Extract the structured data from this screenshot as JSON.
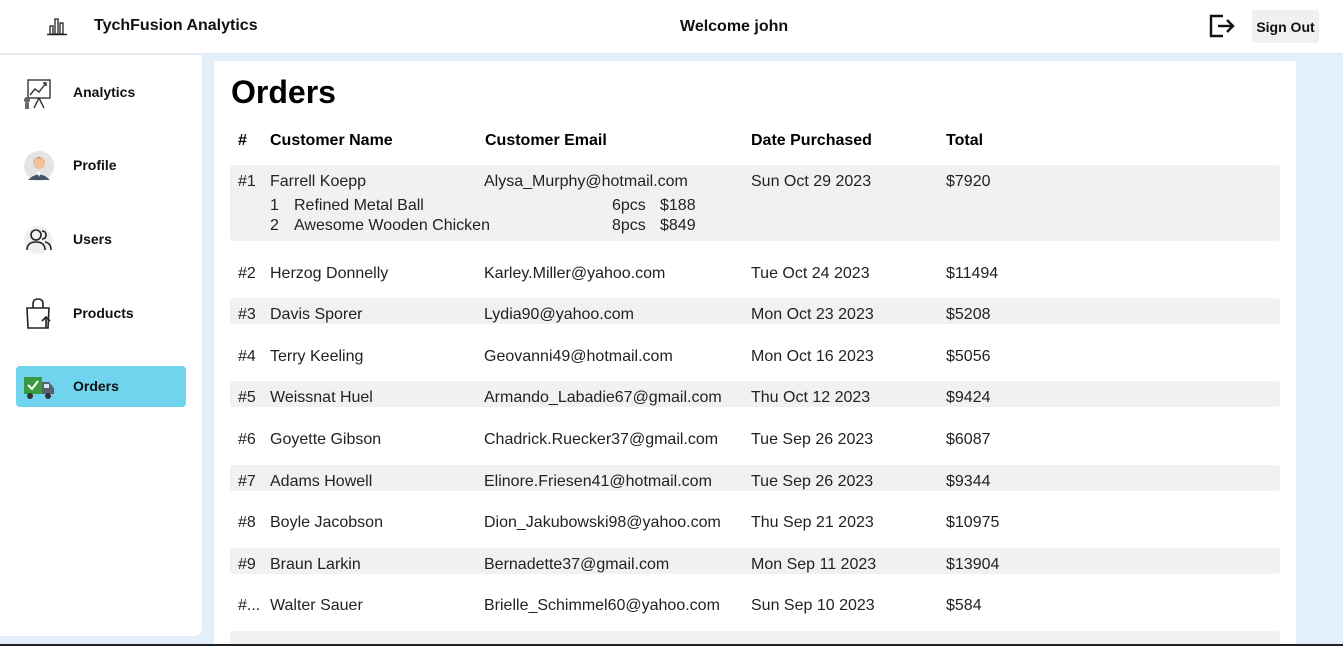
{
  "header": {
    "app_title": "TychFusion Analytics",
    "logo_icon": "bar-chart-icon",
    "welcome": "Welcome john",
    "signout_icon": "logout-icon",
    "signout_label": "Sign Out"
  },
  "sidebar": {
    "items": [
      {
        "label": "Analytics",
        "icon": "analytics-icon",
        "active": false
      },
      {
        "label": "Profile",
        "icon": "profile-avatar-icon",
        "active": false
      },
      {
        "label": "Users",
        "icon": "users-icon",
        "active": false
      },
      {
        "label": "Products",
        "icon": "shopping-bag-icon",
        "active": false
      },
      {
        "label": "Orders",
        "icon": "delivery-truck-icon",
        "active": true
      }
    ],
    "active_color": "#71d4ee"
  },
  "main": {
    "title": "Orders",
    "columns": [
      "#",
      "Customer Name",
      "Customer Email",
      "Date Purchased",
      "Total"
    ],
    "orders": [
      {
        "num": "#1",
        "name": "Farrell Koepp",
        "email": "Alysa_Murphy@hotmail.com",
        "date": "Sun Oct 29 2023",
        "total": "$7920",
        "items": [
          {
            "idx": "1",
            "name": "Refined Metal Ball",
            "qty": "6pcs",
            "price": "$188"
          },
          {
            "idx": "2",
            "name": "Awesome Wooden Chicken",
            "qty": "8pcs",
            "price": "$849"
          }
        ]
      },
      {
        "num": "#2",
        "name": "Herzog Donnelly",
        "email": "Karley.Miller@yahoo.com",
        "date": "Tue Oct 24 2023",
        "total": "$11494"
      },
      {
        "num": "#3",
        "name": "Davis Sporer",
        "email": "Lydia90@yahoo.com",
        "date": "Mon Oct 23 2023",
        "total": "$5208"
      },
      {
        "num": "#4",
        "name": "Terry Keeling",
        "email": "Geovanni49@hotmail.com",
        "date": "Mon Oct 16 2023",
        "total": "$5056"
      },
      {
        "num": "#5",
        "name": "Weissnat Huel",
        "email": "Armando_Labadie67@gmail.com",
        "date": "Thu Oct 12 2023",
        "total": "$9424"
      },
      {
        "num": "#6",
        "name": "Goyette Gibson",
        "email": "Chadrick.Ruecker37@gmail.com",
        "date": "Tue Sep 26 2023",
        "total": "$6087"
      },
      {
        "num": "#7",
        "name": "Adams Howell",
        "email": "Elinore.Friesen41@hotmail.com",
        "date": "Tue Sep 26 2023",
        "total": "$9344"
      },
      {
        "num": "#8",
        "name": "Boyle Jacobson",
        "email": "Dion_Jakubowski98@yahoo.com",
        "date": "Thu Sep 21 2023",
        "total": "$10975"
      },
      {
        "num": "#9",
        "name": "Braun Larkin",
        "email": "Bernadette37@gmail.com",
        "date": "Mon Sep 11 2023",
        "total": "$13904"
      },
      {
        "num": "#...",
        "name": "Walter Sauer",
        "email": "Brielle_Schimmel60@yahoo.com",
        "date": "Sun Sep 10 2023",
        "total": "$584"
      }
    ]
  }
}
